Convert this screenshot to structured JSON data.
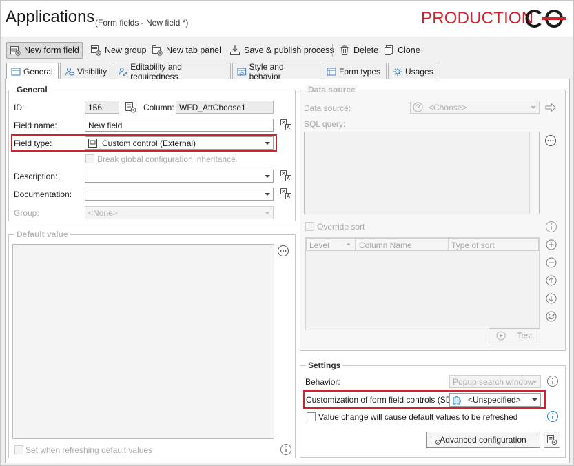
{
  "window": {
    "title": "Applications",
    "subtitle": "(Form fields - New field *)",
    "environment": "PRODUCTION",
    "accent_color": "#d3202b"
  },
  "toolbar": {
    "new_form_field": "New form field",
    "new_group": "New group",
    "new_tab_panel": "New tab panel",
    "save_publish": "Save & publish process",
    "delete": "Delete",
    "clone": "Clone"
  },
  "tabs": [
    {
      "label": "General",
      "icon": "general-icon",
      "active": true
    },
    {
      "label": "Visibility",
      "icon": "visibility-icon"
    },
    {
      "label": "Editability and requiredness",
      "icon": "editability-icon"
    },
    {
      "label": "Style and behavior",
      "icon": "style-icon"
    },
    {
      "label": "Form types",
      "icon": "form-types-icon"
    },
    {
      "label": "Usages",
      "icon": "usages-icon"
    }
  ],
  "general": {
    "title": "General",
    "id_label": "ID:",
    "id_value": "156",
    "column_label": "Column:",
    "column_value": "WFD_AttChoose1",
    "field_name_label": "Field name:",
    "field_name_value": "New field",
    "field_type_label": "Field type:",
    "field_type_value": "Custom control (External)",
    "break_inheritance": "Break global configuration inheritance",
    "description_label": "Description:",
    "description_value": "",
    "documentation_label": "Documentation:",
    "documentation_value": "",
    "group_label": "Group:",
    "group_value": "<None>"
  },
  "default_value": {
    "title": "Default value",
    "set_when_refreshing": "Set when refreshing default values"
  },
  "data_source": {
    "title": "Data source",
    "data_source_label": "Data source:",
    "data_source_value": "<Choose>",
    "sql_query_label": "SQL query:",
    "override_sort": "Override sort",
    "columns": [
      "Level",
      "Column Name",
      "Type of sort"
    ],
    "test_button": "Test"
  },
  "settings": {
    "title": "Settings",
    "behavior_label": "Behavior:",
    "behavior_value": "Popup search window",
    "sdk_label": "Customization of form field controls (SDK):",
    "sdk_value": "<Unspecified>",
    "value_change_label": "Value change will cause default values to be refreshed",
    "advanced_button": "Advanced configuration"
  }
}
